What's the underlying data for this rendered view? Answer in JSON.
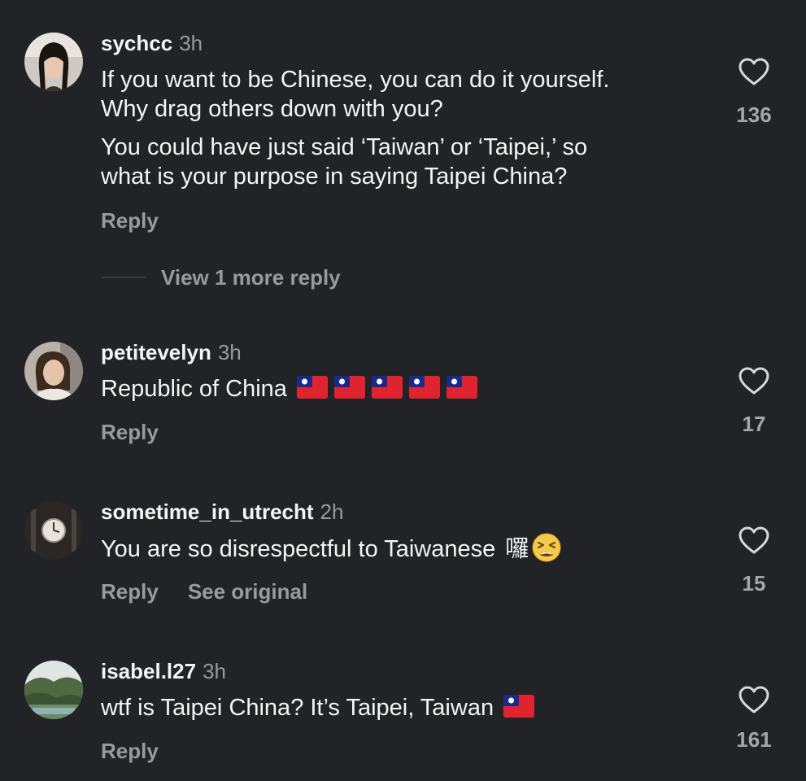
{
  "comments": [
    {
      "username": "sychcc",
      "time": "3h",
      "lines": [
        "If you want to be Chinese, you can do it yourself.",
        "Why drag others down with you?",
        "You could have just said ‘Taiwan’ or ‘Taipei,’ so",
        "what is your purpose in saying Taipei China?"
      ],
      "reply_label": "Reply",
      "likes": "136",
      "view_more": "View 1 more reply"
    },
    {
      "username": "petitevelyn",
      "time": "3h",
      "text": "Republic of China",
      "flag_count": 5,
      "reply_label": "Reply",
      "likes": "17"
    },
    {
      "username": "sometime_in_utrecht",
      "time": "2h",
      "text": "You are so disrespectful to Taiwanese",
      "suffix_char": "囉",
      "emoji": "tired-face-emoji",
      "reply_label": "Reply",
      "see_original_label": "See original",
      "likes": "15"
    },
    {
      "username": "isabel.l27",
      "time": "3h",
      "text": "wtf is Taipei China? It’s Taipei,  Taiwan",
      "flag_count": 1,
      "reply_label": "Reply",
      "likes": "161"
    }
  ],
  "icons": {
    "like": "heart-outline-icon",
    "flag": "taiwan-flag-emoji"
  },
  "colors": {
    "background": "#222327",
    "text_primary": "#f4f4f4",
    "text_secondary": "#9a9a9a",
    "flag_red": "#e0242f",
    "flag_blue": "#1a2a8c"
  }
}
